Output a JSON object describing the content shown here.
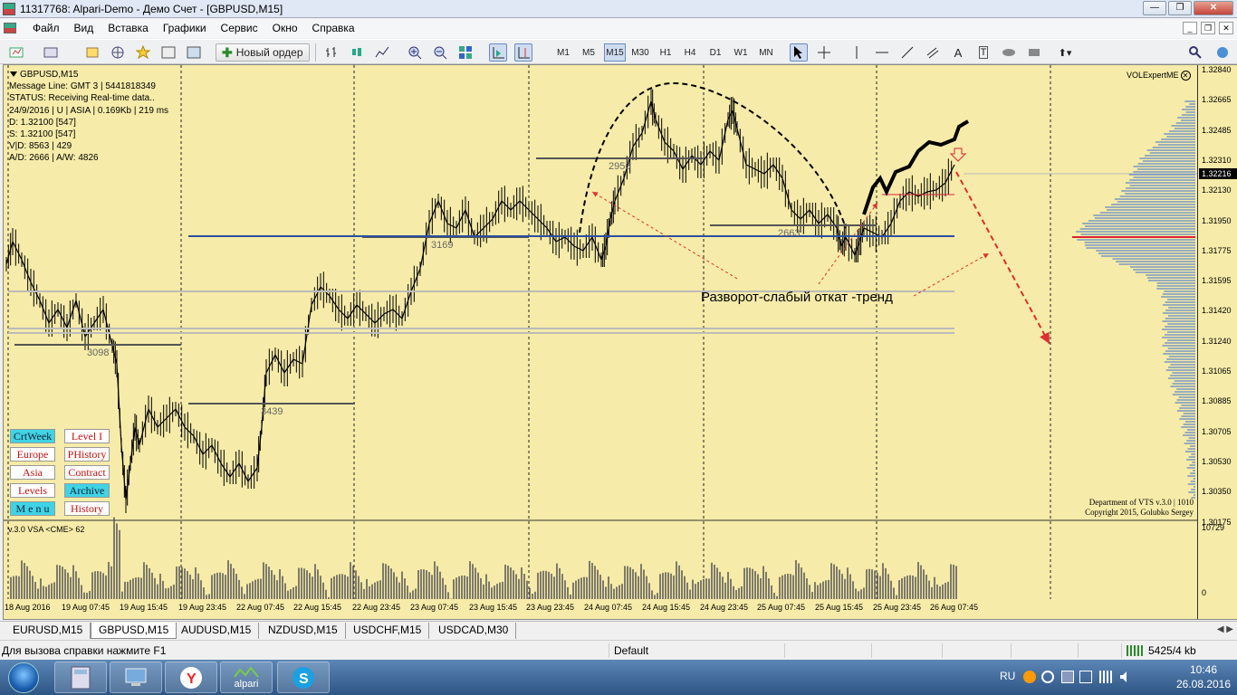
{
  "window": {
    "title": "11317768: Alpari-Demo - Демо Счет - [GBPUSD,M15]",
    "minimize": "—",
    "restore": "❐",
    "close": "✕"
  },
  "menu": [
    "Файл",
    "Вид",
    "Вставка",
    "Графики",
    "Сервис",
    "Окно",
    "Справка"
  ],
  "toolbar": {
    "new_order": "Новый ордер",
    "timeframes": [
      "M1",
      "M5",
      "M15",
      "M30",
      "H1",
      "H4",
      "D1",
      "W1",
      "MN"
    ],
    "active_tf": "M15"
  },
  "chart": {
    "info": [
      "GBPUSD,M15",
      "Message Line: GMT 3 | 5441818349",
      "STATUS:  Receiving Real-time data..",
      "24/9/2016 | U | ASIA | 0.169Kb | 219 ms",
      "D: 1.32100  [547]",
      "S: 1.32100  [547]",
      "V|D: 8563 | 429",
      "A/D: 2666 | A/W: 4826"
    ],
    "expert": "VOLExpertME",
    "expert_icon": "close-circle-icon",
    "buttons": [
      [
        "CrtWeek",
        "Level I"
      ],
      [
        "Europe",
        "PHistory"
      ],
      [
        "Asia",
        "Contract"
      ],
      [
        "Levels",
        "Archive"
      ],
      [
        "M e n u",
        "History"
      ]
    ],
    "button_styles": [
      [
        "cyan",
        "white"
      ],
      [
        "white",
        "white"
      ],
      [
        "white",
        "white"
      ],
      [
        "white",
        "cyan"
      ],
      [
        "cyan",
        "white"
      ]
    ],
    "copyright": [
      "Department of VTS  v.3.0 | 1010",
      "Copyright 2015, Golubko Sergey"
    ],
    "annotation": "Разворот-слабый откат -тренд",
    "level_labels": [
      "3098",
      "3439",
      "3169",
      "2956",
      "2663"
    ],
    "price_axis": [
      "1.32840",
      "1.32665",
      "1.32485",
      "1.32310",
      "1.32130",
      "1.31950",
      "1.31775",
      "1.31595",
      "1.31420",
      "1.31240",
      "1.31065",
      "1.30885",
      "1.30705",
      "1.30530",
      "1.30350",
      "1.30175"
    ],
    "current_price": "1.32216",
    "vsa_label": "v.3.0 VSA <CME> 62",
    "vol_max": "10729",
    "vol_zero": "0",
    "time_axis": [
      "18 Aug 2016",
      "19 Aug 07:45",
      "19 Aug 15:45",
      "19 Aug 23:45",
      "22 Aug 07:45",
      "22 Aug 15:45",
      "22 Aug 23:45",
      "23 Aug 07:45",
      "23 Aug 15:45",
      "23 Aug 23:45",
      "24 Aug 07:45",
      "24 Aug 15:45",
      "24 Aug 23:45",
      "25 Aug 07:45",
      "25 Aug 15:45",
      "25 Aug 23:45",
      "26 Aug 07:45"
    ],
    "colors": {
      "background": "#f6eba8",
      "candle": "#000000",
      "blue_line": "#2b4f9e",
      "arrow": "#e03030",
      "profile": "#3a6fd0"
    }
  },
  "tabs": [
    "EURUSD,M15",
    "GBPUSD,M15",
    "AUDUSD,M15",
    "NZDUSD,M15",
    "USDCHF,M15",
    "USDCAD,M30"
  ],
  "active_tab": "GBPUSD,M15",
  "status": {
    "help": "Для вызова справки нажмите F1",
    "profile": "Default",
    "connection": "5425/4 kb"
  },
  "taskbar": {
    "items": [
      "calculator",
      "remote-desktop",
      "yandex",
      "alpari",
      "skype"
    ],
    "alpari_label": "alpari",
    "lang": "RU",
    "time": "10:46",
    "date": "26.08.2016"
  }
}
